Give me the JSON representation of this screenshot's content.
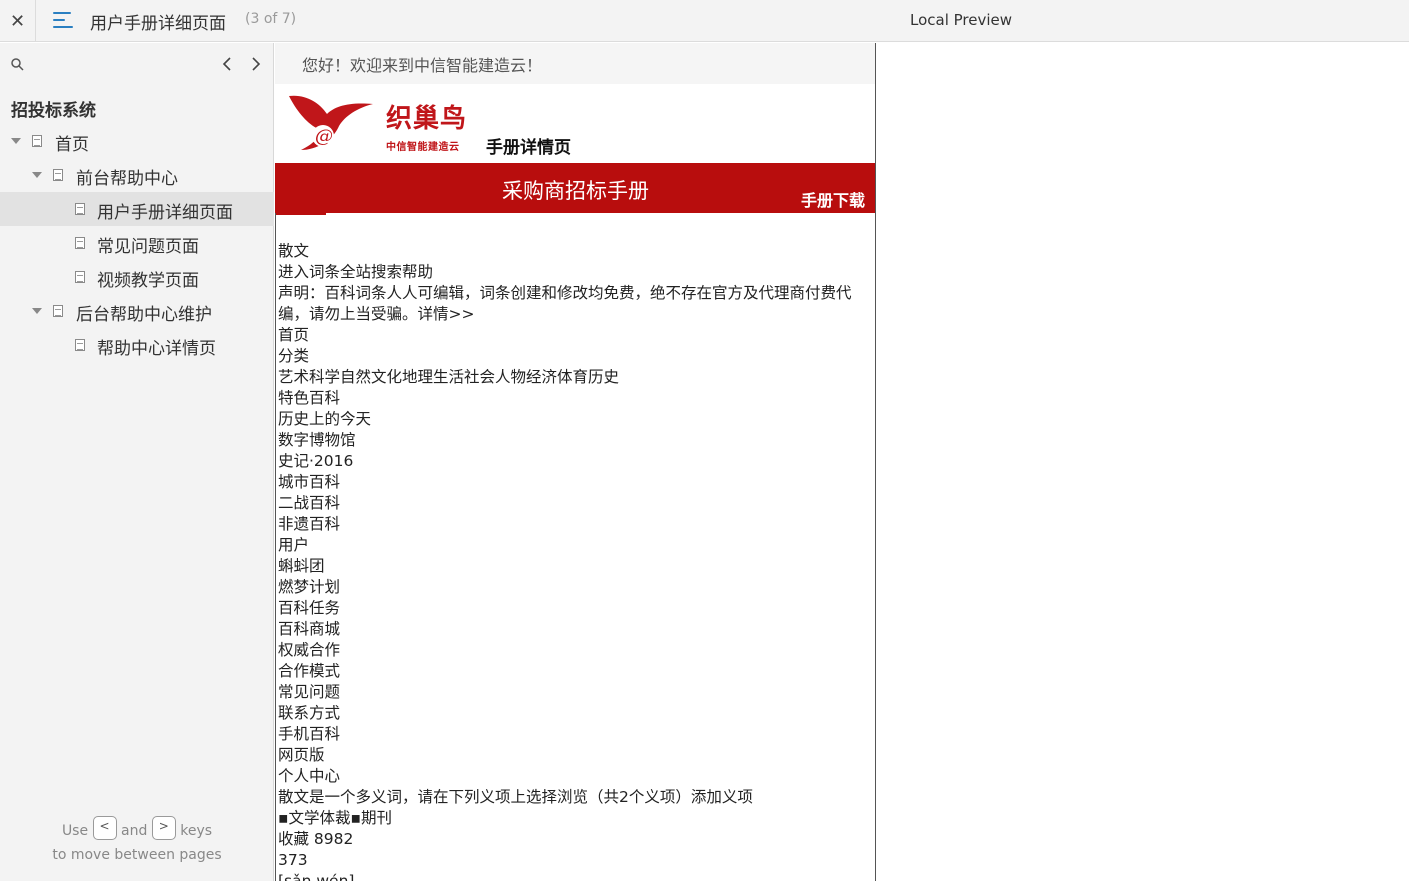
{
  "topbar": {
    "close_glyph": "✕",
    "title": "用户手册详细页面",
    "page_count": "(3 of 7)",
    "preview_label": "Local Preview"
  },
  "sidebar": {
    "heading": "招投标系统",
    "items": [
      {
        "label": "首页",
        "level": 0,
        "expanded": true,
        "active": false
      },
      {
        "label": "前台帮助中心",
        "level": 1,
        "expanded": true,
        "active": false
      },
      {
        "label": "用户手册详细页面",
        "level": 2,
        "active": true
      },
      {
        "label": "常见问题页面",
        "level": 2,
        "active": false
      },
      {
        "label": "视频教学页面",
        "level": 2,
        "active": false
      },
      {
        "label": "后台帮助中心维护",
        "level": 1,
        "expanded": true,
        "active": false
      },
      {
        "label": "帮助中心详情页",
        "level": 2,
        "active": false
      }
    ],
    "hint": {
      "use": "Use",
      "prev_key": "<",
      "and": "and",
      "next_key": ">",
      "keys": "keys",
      "line2": "to move between pages"
    }
  },
  "content": {
    "welcome": "您好！欢迎来到中信智能建造云！",
    "logo_name": "织巢鸟",
    "logo_sub": "中信智能建造云",
    "detail_title": "手册详情页",
    "banner_title": "采购商招标手册",
    "download_label": "手册下载",
    "lines": [
      "散文",
      "进入词条全站搜索帮助",
      "声明：百科词条人人可编辑，词条创建和修改均免费，绝不存在官方及代理商付费代编，请勿上当受骗。详情>>",
      "首页",
      "分类",
      "艺术科学自然文化地理生活社会人物经济体育历史",
      "特色百科",
      "历史上的今天",
      "数字博物馆",
      "史记·2016",
      "城市百科",
      "二战百科",
      "非遗百科",
      "用户",
      "蝌蚪团",
      "燃梦计划",
      "百科任务",
      "百科商城",
      "权威合作",
      "合作模式",
      "常见问题",
      "联系方式",
      "手机百科",
      "网页版",
      "个人中心",
      "散文是一个多义词，请在下列义项上选择浏览（共2个义项）添加义项",
      "▪文学体裁▪期刊",
      "收藏 8982",
      "373",
      "[sǎn wén]"
    ]
  },
  "colors": {
    "accent_blue": "#2a7fc1",
    "brand_red": "#b80d0d",
    "sidebar_bg": "#f3f3f3"
  }
}
